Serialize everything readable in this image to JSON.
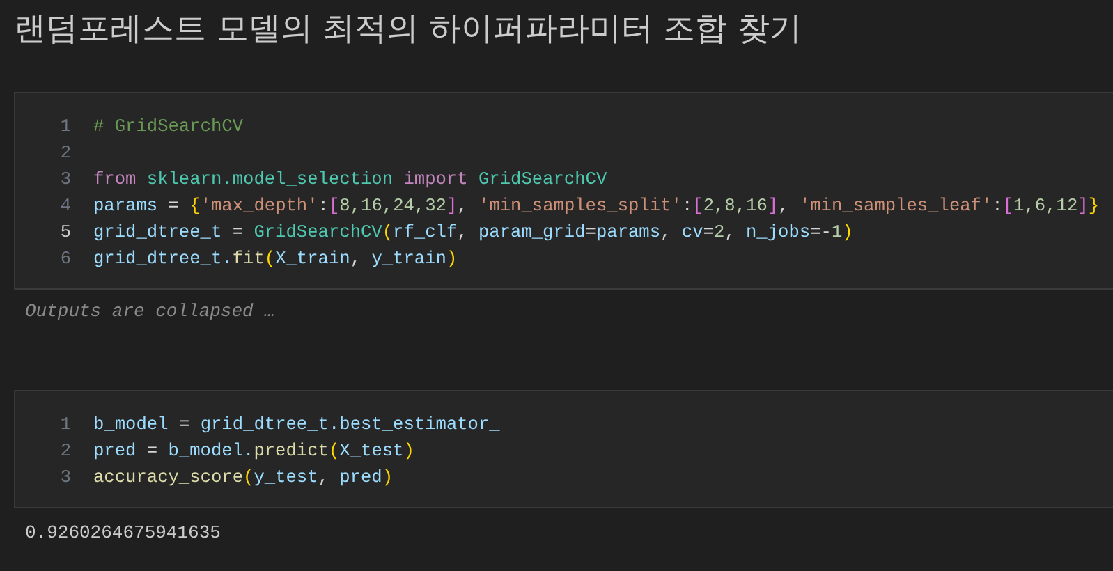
{
  "heading": "랜덤포레스트 모델의 최적의 하이퍼파라미터 조합 찾기",
  "cells": [
    {
      "lines": [
        {
          "number": "1",
          "current": false,
          "tokens": [
            {
              "kind": "comment",
              "text": "# GridSearchCV"
            }
          ]
        },
        {
          "number": "2",
          "current": false
        },
        {
          "number": "3",
          "current": false,
          "tokens": [
            {
              "kind": "keyword",
              "text": "from"
            },
            {
              "kind": "class",
              "text": " sklearn.model_selection"
            },
            {
              "kind": "keyword",
              "text": " import"
            },
            {
              "kind": "class",
              "text": " GridSearchCV"
            }
          ]
        },
        {
          "number": "4",
          "current": false,
          "tokens": [
            {
              "kind": "var",
              "text": "params"
            },
            {
              "kind": "op",
              "text": " = "
            },
            {
              "kind": "bracket1",
              "text": "{"
            },
            {
              "kind": "string",
              "text": "'max_depth'"
            },
            {
              "kind": "op",
              "text": ":"
            },
            {
              "kind": "bracket2",
              "text": "["
            },
            {
              "kind": "number",
              "text": "8,16,24,32"
            },
            {
              "kind": "bracket2",
              "text": "]"
            },
            {
              "kind": "op",
              "text": ", "
            },
            {
              "kind": "string",
              "text": "'min_samples_split'"
            },
            {
              "kind": "op",
              "text": ":"
            },
            {
              "kind": "bracket2",
              "text": "["
            },
            {
              "kind": "number",
              "text": "2,8,16"
            },
            {
              "kind": "bracket2",
              "text": "]"
            },
            {
              "kind": "op",
              "text": ", "
            },
            {
              "kind": "string",
              "text": "'min_samples_leaf'"
            },
            {
              "kind": "op",
              "text": ":"
            },
            {
              "kind": "bracket2",
              "text": "["
            },
            {
              "kind": "number",
              "text": "1,6,12"
            },
            {
              "kind": "bracket2",
              "text": "]"
            },
            {
              "kind": "bracket1",
              "text": "}"
            }
          ]
        },
        {
          "number": "5",
          "current": true,
          "tokens": [
            {
              "kind": "var",
              "text": "grid_dtree_t"
            },
            {
              "kind": "op",
              "text": " = "
            },
            {
              "kind": "class",
              "text": "GridSearchCV"
            },
            {
              "kind": "bracket1",
              "text": "("
            },
            {
              "kind": "var",
              "text": "rf_clf"
            },
            {
              "kind": "op",
              "text": ", "
            },
            {
              "kind": "var",
              "text": "param_grid"
            },
            {
              "kind": "op",
              "text": "="
            },
            {
              "kind": "var",
              "text": "params"
            },
            {
              "kind": "op",
              "text": ", "
            },
            {
              "kind": "var",
              "text": "cv"
            },
            {
              "kind": "op",
              "text": "="
            },
            {
              "kind": "number",
              "text": "2"
            },
            {
              "kind": "op",
              "text": ", "
            },
            {
              "kind": "var",
              "text": "n_jobs"
            },
            {
              "kind": "op",
              "text": "=-"
            },
            {
              "kind": "number",
              "text": "1"
            },
            {
              "kind": "bracket1",
              "text": ")"
            }
          ]
        },
        {
          "number": "6",
          "current": false,
          "tokens": [
            {
              "kind": "var",
              "text": "grid_dtree_t."
            },
            {
              "kind": "func",
              "text": "fit"
            },
            {
              "kind": "bracket1",
              "text": "("
            },
            {
              "kind": "var",
              "text": "X_train"
            },
            {
              "kind": "op",
              "text": ", "
            },
            {
              "kind": "var",
              "text": "y_train"
            },
            {
              "kind": "bracket1",
              "text": ")"
            }
          ]
        }
      ],
      "output": {
        "kind": "collapsed",
        "text": "Outputs are collapsed …"
      }
    },
    {
      "lines": [
        {
          "number": "1",
          "current": false,
          "tokens": [
            {
              "kind": "var",
              "text": "b_model"
            },
            {
              "kind": "op",
              "text": " = "
            },
            {
              "kind": "var",
              "text": "grid_dtree_t.best_estimator_"
            }
          ]
        },
        {
          "number": "2",
          "current": false,
          "tokens": [
            {
              "kind": "var",
              "text": "pred"
            },
            {
              "kind": "op",
              "text": " = "
            },
            {
              "kind": "var",
              "text": "b_model."
            },
            {
              "kind": "func",
              "text": "predict"
            },
            {
              "kind": "bracket1",
              "text": "("
            },
            {
              "kind": "var",
              "text": "X_test"
            },
            {
              "kind": "bracket1",
              "text": ")"
            }
          ]
        },
        {
          "number": "3",
          "current": false,
          "tokens": [
            {
              "kind": "func",
              "text": "accuracy_score"
            },
            {
              "kind": "bracket1",
              "text": "("
            },
            {
              "kind": "var",
              "text": "y_test"
            },
            {
              "kind": "op",
              "text": ", "
            },
            {
              "kind": "var",
              "text": "pred"
            },
            {
              "kind": "bracket1",
              "text": ")"
            }
          ]
        }
      ],
      "output": {
        "kind": "result",
        "text": "0.9260264675941635"
      }
    }
  ]
}
